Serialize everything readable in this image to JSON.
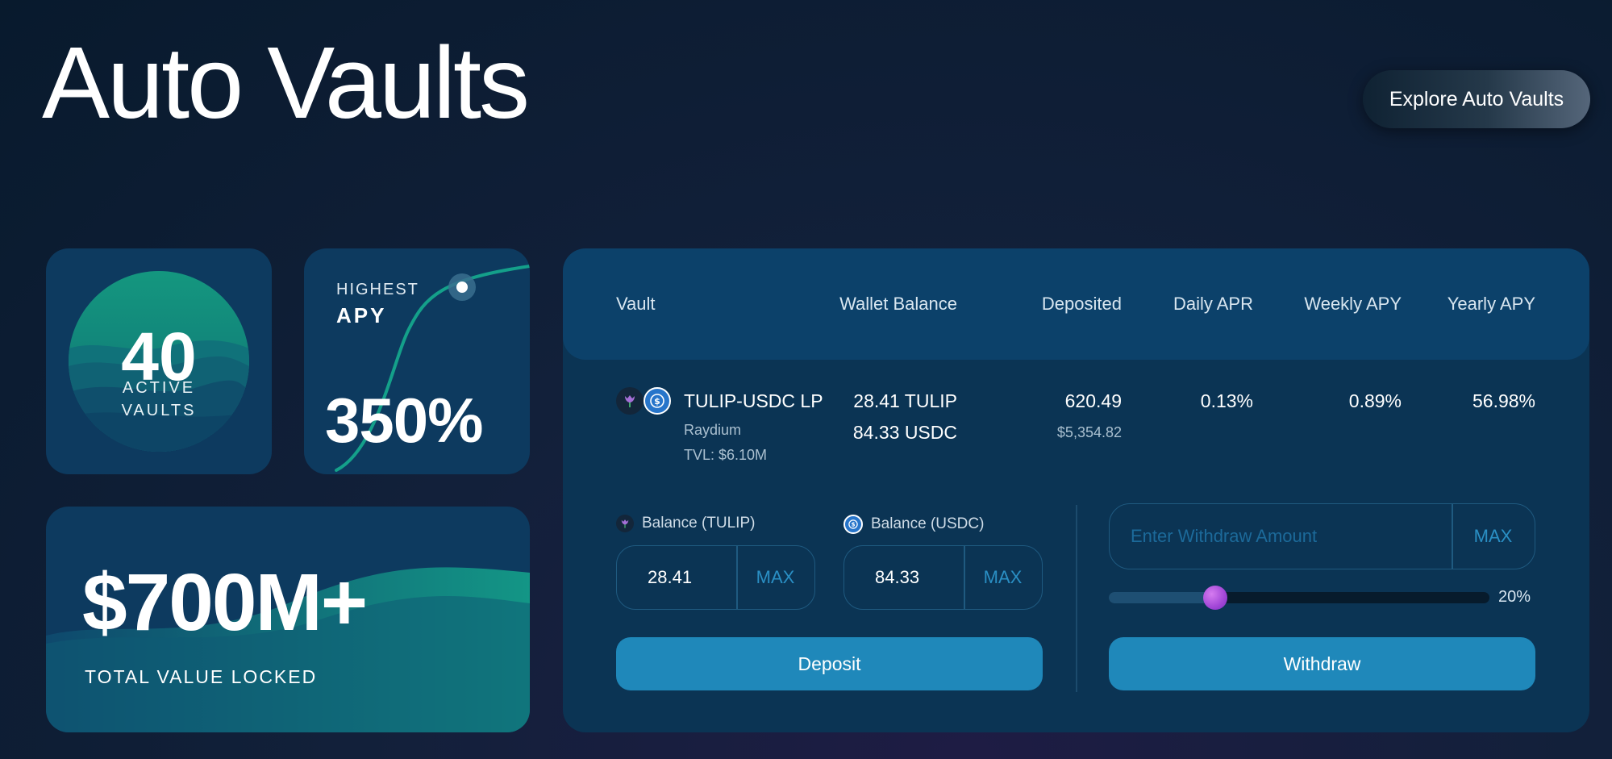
{
  "page": {
    "title": "Auto Vaults",
    "explore_label": "Explore Auto Vaults"
  },
  "stats": {
    "active_vaults": {
      "number": "40",
      "label_line1": "ACTIVE",
      "label_line2": "VAULTS"
    },
    "highest_apy": {
      "label_line1": "HIGHEST",
      "label_line2": "APY",
      "value": "350%"
    },
    "tvl": {
      "value": "$700M+",
      "label": "TOTAL VALUE LOCKED"
    }
  },
  "table": {
    "headers": [
      "Vault",
      "Wallet Balance",
      "Deposited",
      "Daily APR",
      "Weekly APY",
      "Yearly APY"
    ],
    "row": {
      "vault_name": "TULIP-USDC LP",
      "platform": "Raydium",
      "tvl": "TVL: $6.10M",
      "wallet_balance_1": "28.41 TULIP",
      "wallet_balance_2": "84.33 USDC",
      "deposited": "620.49",
      "deposited_usd": "$5,354.82",
      "daily_apr": "0.13%",
      "weekly_apy": "0.89%",
      "yearly_apy": "56.98%",
      "icons": [
        "tulip-icon",
        "usdc-icon"
      ]
    }
  },
  "deposit": {
    "tulip_label": "Balance (TULIP)",
    "tulip_value": "28.41",
    "usdc_label": "Balance (USDC)",
    "usdc_value": "84.33",
    "max_label": "MAX",
    "button_label": "Deposit"
  },
  "withdraw": {
    "placeholder": "Enter Withdraw Amount",
    "max_label": "MAX",
    "slider_percent": 20,
    "slider_label": "20%",
    "button_label": "Withdraw"
  },
  "colors": {
    "background": "#081a2d",
    "card": "#0d3a5f",
    "accent": "#1f88ba",
    "teal": "#14a08a",
    "slider_knob": "#a146d6"
  }
}
